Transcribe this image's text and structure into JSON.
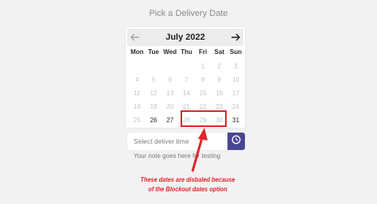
{
  "page": {
    "title": "Pick a Delivery Date"
  },
  "calendar": {
    "month_label": "July 2022",
    "weekdays": [
      "Mon",
      "Tue",
      "Wed",
      "Thu",
      "Fri",
      "Sat",
      "Sun"
    ],
    "weeks": [
      [
        {
          "label": "",
          "state": "empty"
        },
        {
          "label": "",
          "state": "empty"
        },
        {
          "label": "",
          "state": "empty"
        },
        {
          "label": "",
          "state": "empty"
        },
        {
          "label": "1",
          "state": "disabled"
        },
        {
          "label": "2",
          "state": "disabled"
        },
        {
          "label": "3",
          "state": "disabled"
        }
      ],
      [
        {
          "label": "4",
          "state": "disabled"
        },
        {
          "label": "5",
          "state": "disabled"
        },
        {
          "label": "6",
          "state": "disabled"
        },
        {
          "label": "7",
          "state": "disabled"
        },
        {
          "label": "8",
          "state": "disabled"
        },
        {
          "label": "9",
          "state": "disabled"
        },
        {
          "label": "10",
          "state": "disabled"
        }
      ],
      [
        {
          "label": "11",
          "state": "disabled"
        },
        {
          "label": "12",
          "state": "disabled"
        },
        {
          "label": "13",
          "state": "disabled"
        },
        {
          "label": "14",
          "state": "disabled"
        },
        {
          "label": "15",
          "state": "disabled"
        },
        {
          "label": "16",
          "state": "disabled"
        },
        {
          "label": "17",
          "state": "disabled"
        }
      ],
      [
        {
          "label": "18",
          "state": "disabled"
        },
        {
          "label": "19",
          "state": "disabled"
        },
        {
          "label": "20",
          "state": "disabled"
        },
        {
          "label": "21",
          "state": "disabled"
        },
        {
          "label": "22",
          "state": "disabled"
        },
        {
          "label": "23",
          "state": "disabled"
        },
        {
          "label": "24",
          "state": "disabled"
        }
      ],
      [
        {
          "label": "25",
          "state": "disabled"
        },
        {
          "label": "26",
          "state": "active"
        },
        {
          "label": "27",
          "state": "active"
        },
        {
          "label": "28",
          "state": "disabled"
        },
        {
          "label": "29",
          "state": "disabled"
        },
        {
          "label": "30",
          "state": "disabled"
        },
        {
          "label": "31",
          "state": "active"
        }
      ]
    ],
    "prev_icon": "arrow-left-icon",
    "next_icon": "arrow-right-icon"
  },
  "time_field": {
    "placeholder": "Select deliver time",
    "value": "",
    "icon": "clock-icon"
  },
  "note": "Your note goes here for testing",
  "annotation": {
    "line1": "These dates are disbaled because",
    "line2": "of the Blockout dates option"
  },
  "colors": {
    "accent": "#4a4694",
    "annotation_red": "#e0242a",
    "disabled_day": "#c4c4c4",
    "background": "#f2f2f2"
  }
}
